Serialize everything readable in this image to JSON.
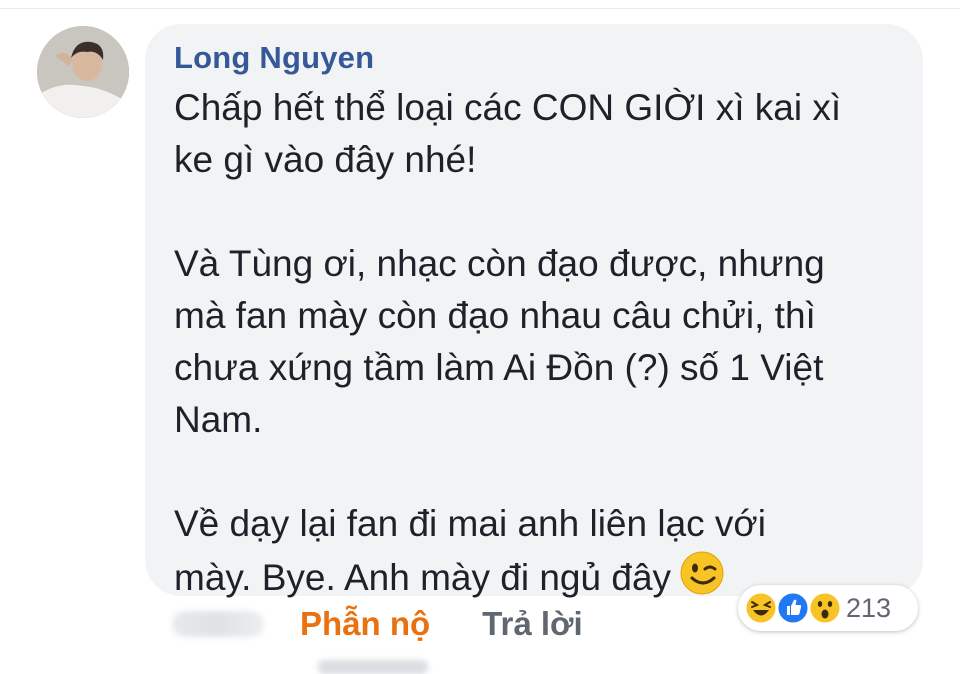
{
  "comment": {
    "author": "Long Nguyen",
    "text": "Chấp hết thể loại các CON GIỜI xì kai xì\nke gì vào đây nhé!\n\nVà Tùng ơi, nhạc còn đạo được, nhưng\nmà fan mày còn đạo nhau câu chửi, thì\nchưa xứng tầm làm Ai Đồn (?) số 1 Việt\nNam.\n\nVề dạy lại fan đi mai anh liên lạc với\nmày. Bye. Anh mày đi ngủ đây",
    "trailing_emoji": "wink-emoji"
  },
  "actions": {
    "reaction_label": "Phẫn nộ",
    "reply_label": "Trả lời"
  },
  "reactions": {
    "icons": [
      "haha-icon",
      "like-icon",
      "wow-icon"
    ],
    "count": "213"
  },
  "colors": {
    "author": "#365899",
    "bubble": "#f2f3f5",
    "active_reaction": "#e9710f",
    "like_blue": "#2078f4",
    "emoji_yellow": "#f7b125"
  }
}
